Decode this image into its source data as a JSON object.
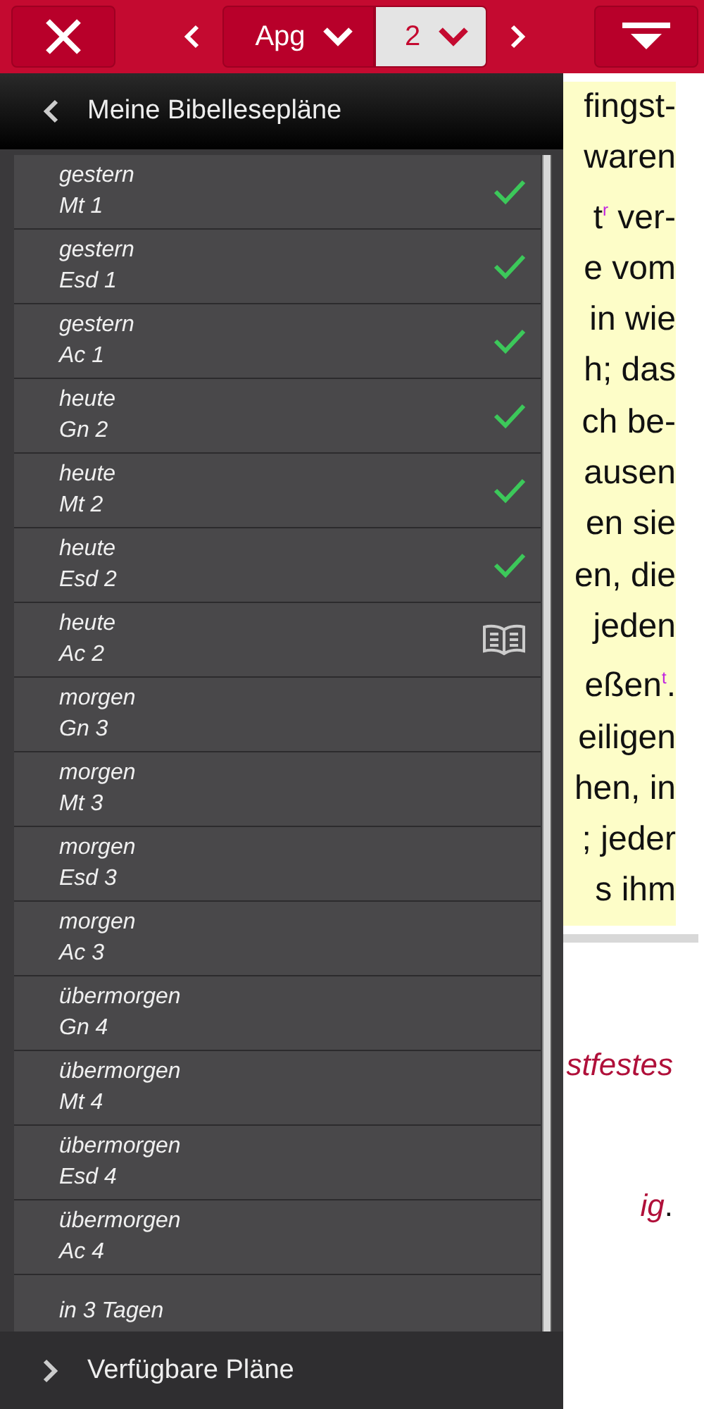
{
  "toolbar": {
    "book": "Apg",
    "chapter": "2"
  },
  "drawer": {
    "title": "Meine Bibellesepläne",
    "footer": "Verfügbare Pläne",
    "items": [
      {
        "when": "gestern",
        "ref": "Mt 1",
        "checked": true,
        "current": false
      },
      {
        "when": "gestern",
        "ref": "Esd 1",
        "checked": true,
        "current": false
      },
      {
        "when": "gestern",
        "ref": "Ac 1",
        "checked": true,
        "current": false
      },
      {
        "when": "heute",
        "ref": "Gn 2",
        "checked": true,
        "current": false
      },
      {
        "when": "heute",
        "ref": "Mt 2",
        "checked": true,
        "current": false
      },
      {
        "when": "heute",
        "ref": "Esd 2",
        "checked": true,
        "current": false
      },
      {
        "when": "heute",
        "ref": "Ac 2",
        "checked": false,
        "current": true
      },
      {
        "when": "morgen",
        "ref": "Gn 3",
        "checked": false,
        "current": false
      },
      {
        "when": "morgen",
        "ref": "Mt 3",
        "checked": false,
        "current": false
      },
      {
        "when": "morgen",
        "ref": "Esd 3",
        "checked": false,
        "current": false
      },
      {
        "when": "morgen",
        "ref": "Ac 3",
        "checked": false,
        "current": false
      },
      {
        "when": "übermorgen",
        "ref": "Gn 4",
        "checked": false,
        "current": false
      },
      {
        "when": "übermorgen",
        "ref": "Mt 4",
        "checked": false,
        "current": false
      },
      {
        "when": "übermorgen",
        "ref": "Esd 4",
        "checked": false,
        "current": false
      },
      {
        "when": "übermorgen",
        "ref": "Ac 4",
        "checked": false,
        "current": false
      },
      {
        "when": "in 3 Tagen",
        "checked": false,
        "current": false
      }
    ]
  },
  "text_lines": [
    "fingst-",
    "waren",
    "t$^{r}$ ver-",
    "e vom",
    "in wie",
    "h; das",
    "ch be-",
    "ausen",
    "en sie",
    "en, die",
    "jeden",
    "eßen$^{t}$.",
    "eiligen",
    "hen, in",
    "; jeder",
    "s ihm"
  ],
  "notes": [
    {
      "text": "stfestes"
    },
    {
      "text": "ig",
      "tail": "."
    }
  ]
}
